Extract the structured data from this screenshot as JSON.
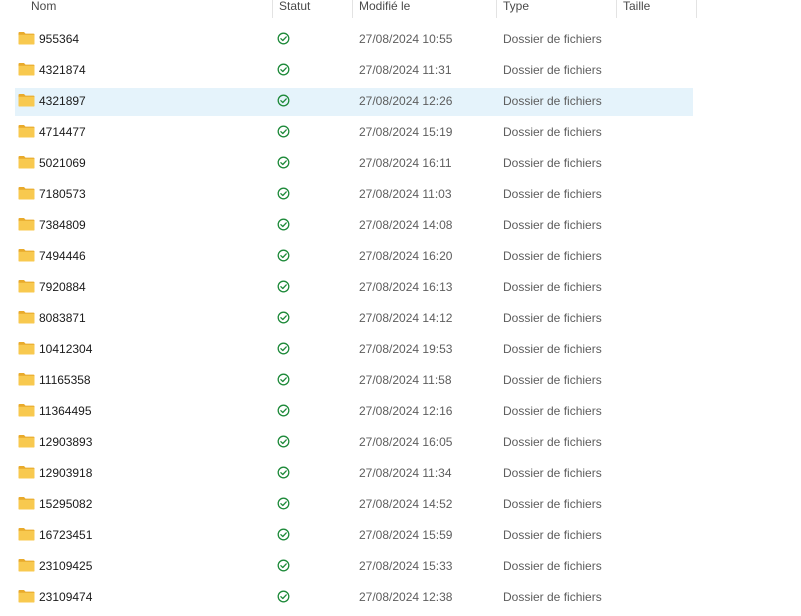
{
  "columns": {
    "name": "Nom",
    "status": "Statut",
    "modified": "Modifié le",
    "type": "Type",
    "size": "Taille"
  },
  "icons": {
    "folder": "folder-icon",
    "status": "sync-ok-check-icon",
    "folder_color": "#f5c346",
    "status_color": "#1e8a3a"
  },
  "selection_color": "#e5f3fb",
  "rows": [
    {
      "name": "955364",
      "modified": "27/08/2024 10:55",
      "type": "Dossier de fichiers",
      "size": "",
      "selected": false
    },
    {
      "name": "4321874",
      "modified": "27/08/2024 11:31",
      "type": "Dossier de fichiers",
      "size": "",
      "selected": false
    },
    {
      "name": "4321897",
      "modified": "27/08/2024 12:26",
      "type": "Dossier de fichiers",
      "size": "",
      "selected": true
    },
    {
      "name": "4714477",
      "modified": "27/08/2024 15:19",
      "type": "Dossier de fichiers",
      "size": "",
      "selected": false
    },
    {
      "name": "5021069",
      "modified": "27/08/2024 16:11",
      "type": "Dossier de fichiers",
      "size": "",
      "selected": false
    },
    {
      "name": "7180573",
      "modified": "27/08/2024 11:03",
      "type": "Dossier de fichiers",
      "size": "",
      "selected": false
    },
    {
      "name": "7384809",
      "modified": "27/08/2024 14:08",
      "type": "Dossier de fichiers",
      "size": "",
      "selected": false
    },
    {
      "name": "7494446",
      "modified": "27/08/2024 16:20",
      "type": "Dossier de fichiers",
      "size": "",
      "selected": false
    },
    {
      "name": "7920884",
      "modified": "27/08/2024 16:13",
      "type": "Dossier de fichiers",
      "size": "",
      "selected": false
    },
    {
      "name": "8083871",
      "modified": "27/08/2024 14:12",
      "type": "Dossier de fichiers",
      "size": "",
      "selected": false
    },
    {
      "name": "10412304",
      "modified": "27/08/2024 19:53",
      "type": "Dossier de fichiers",
      "size": "",
      "selected": false
    },
    {
      "name": "11165358",
      "modified": "27/08/2024 11:58",
      "type": "Dossier de fichiers",
      "size": "",
      "selected": false
    },
    {
      "name": "11364495",
      "modified": "27/08/2024 12:16",
      "type": "Dossier de fichiers",
      "size": "",
      "selected": false
    },
    {
      "name": "12903893",
      "modified": "27/08/2024 16:05",
      "type": "Dossier de fichiers",
      "size": "",
      "selected": false
    },
    {
      "name": "12903918",
      "modified": "27/08/2024 11:34",
      "type": "Dossier de fichiers",
      "size": "",
      "selected": false
    },
    {
      "name": "15295082",
      "modified": "27/08/2024 14:52",
      "type": "Dossier de fichiers",
      "size": "",
      "selected": false
    },
    {
      "name": "16723451",
      "modified": "27/08/2024 15:59",
      "type": "Dossier de fichiers",
      "size": "",
      "selected": false
    },
    {
      "name": "23109425",
      "modified": "27/08/2024 15:33",
      "type": "Dossier de fichiers",
      "size": "",
      "selected": false
    },
    {
      "name": "23109474",
      "modified": "27/08/2024 12:38",
      "type": "Dossier de fichiers",
      "size": "",
      "selected": false
    }
  ]
}
